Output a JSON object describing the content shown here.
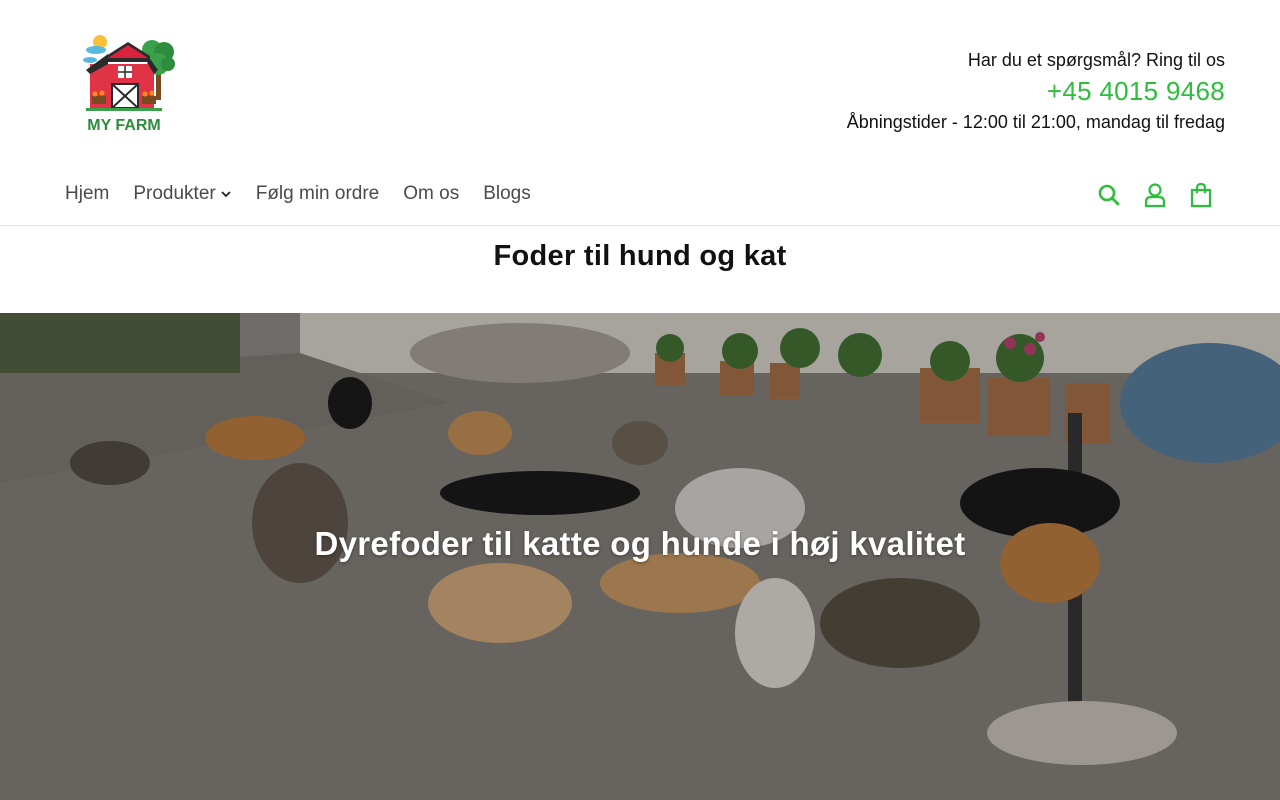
{
  "brand": {
    "logo_text": "MY FARM"
  },
  "contact": {
    "question": "Har du et spørgsmål? Ring til os",
    "phone": "+45 4015 9468",
    "hours": "Åbningstider - 12:00 til 21:00, mandag til fredag"
  },
  "nav": {
    "items": [
      {
        "label": "Hjem"
      },
      {
        "label": "Produkter",
        "has_dropdown": true
      },
      {
        "label": "Følg min ordre"
      },
      {
        "label": "Om os"
      },
      {
        "label": "Blogs"
      }
    ],
    "icons": [
      "search-icon",
      "account-icon",
      "cart-icon"
    ]
  },
  "page": {
    "title": "Foder til hund og kat"
  },
  "hero": {
    "heading": "Dyrefoder til katte og hunde i høj kvalitet"
  },
  "colors": {
    "accent": "#2dbd3b",
    "nav_text": "#4a4a4a",
    "border": "#e6e6e6"
  }
}
